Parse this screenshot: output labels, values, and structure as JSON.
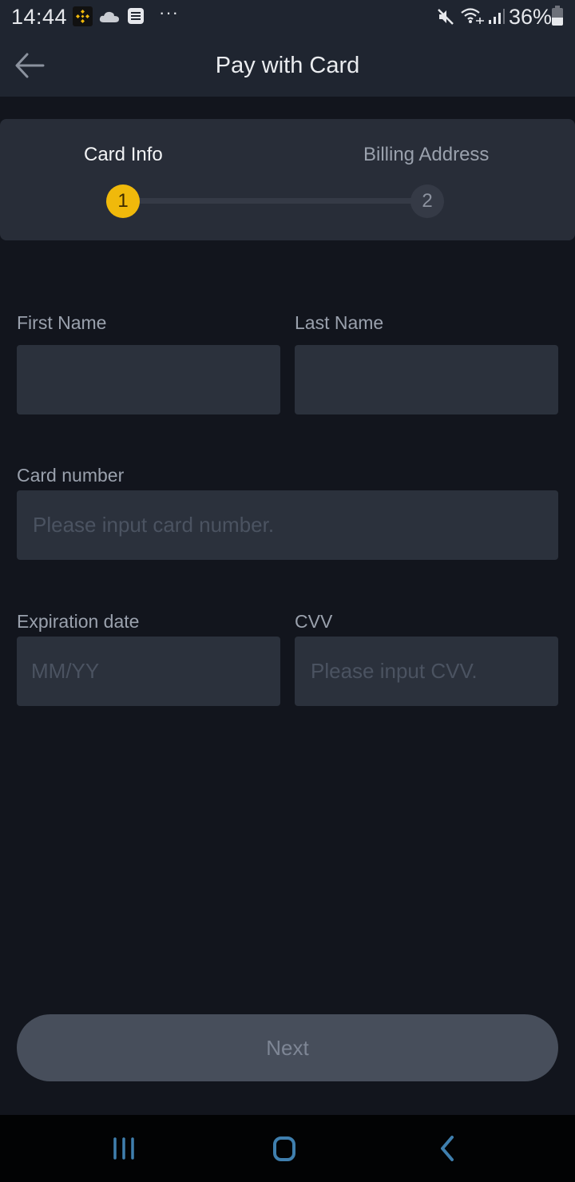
{
  "status_bar": {
    "time": "14:44",
    "battery_percent": "36%",
    "more_indicator": "···",
    "icons": [
      "binance-app-icon",
      "cloud-icon",
      "message-icon",
      "more-icon",
      "mute-icon",
      "wifi-icon",
      "signal-icon",
      "battery-icon"
    ]
  },
  "header": {
    "title": "Pay with Card",
    "back_icon": "arrow-left-icon"
  },
  "stepper": {
    "steps": [
      {
        "number": "1",
        "label": "Card Info",
        "state": "active"
      },
      {
        "number": "2",
        "label": "Billing Address",
        "state": "inactive"
      }
    ],
    "active_color": "#f0b90b"
  },
  "form": {
    "first_name": {
      "label": "First Name",
      "value": "",
      "placeholder": ""
    },
    "last_name": {
      "label": "Last Name",
      "value": "",
      "placeholder": ""
    },
    "card_number": {
      "label": "Card number",
      "value": "",
      "placeholder": "Please input card number."
    },
    "expiration": {
      "label": "Expiration date",
      "value": "",
      "placeholder": "MM/YY"
    },
    "cvv": {
      "label": "CVV",
      "value": "",
      "placeholder": "Please input CVV."
    }
  },
  "actions": {
    "next_label": "Next"
  },
  "nav_bar": {
    "icons": [
      "recent-apps-icon",
      "home-icon",
      "back-icon"
    ]
  }
}
